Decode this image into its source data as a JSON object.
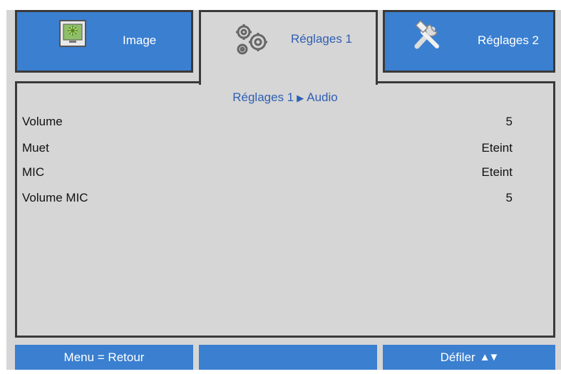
{
  "tabs": [
    {
      "label": "Image",
      "icon": "image-icon",
      "active": false
    },
    {
      "label": "Réglages 1",
      "icon": "gears-icon",
      "active": true
    },
    {
      "label": "Réglages 2",
      "icon": "tools-icon",
      "active": false
    }
  ],
  "breadcrumb": {
    "parent": "Réglages 1",
    "current": "Audio"
  },
  "settings": [
    {
      "label": "Volume",
      "value": "5"
    },
    {
      "label": "Muet",
      "value": "Eteint"
    },
    {
      "label": "MIC",
      "value": "Eteint"
    },
    {
      "label": "Volume MIC",
      "value": "5"
    }
  ],
  "footer": {
    "back_label": "Menu = Retour",
    "middle_label": "",
    "scroll_label": "Défiler"
  },
  "colors": {
    "accent": "#3a7fd0",
    "panel": "#d6d6d6",
    "active_text": "#2f5fb3",
    "border": "#3a3a3a"
  }
}
